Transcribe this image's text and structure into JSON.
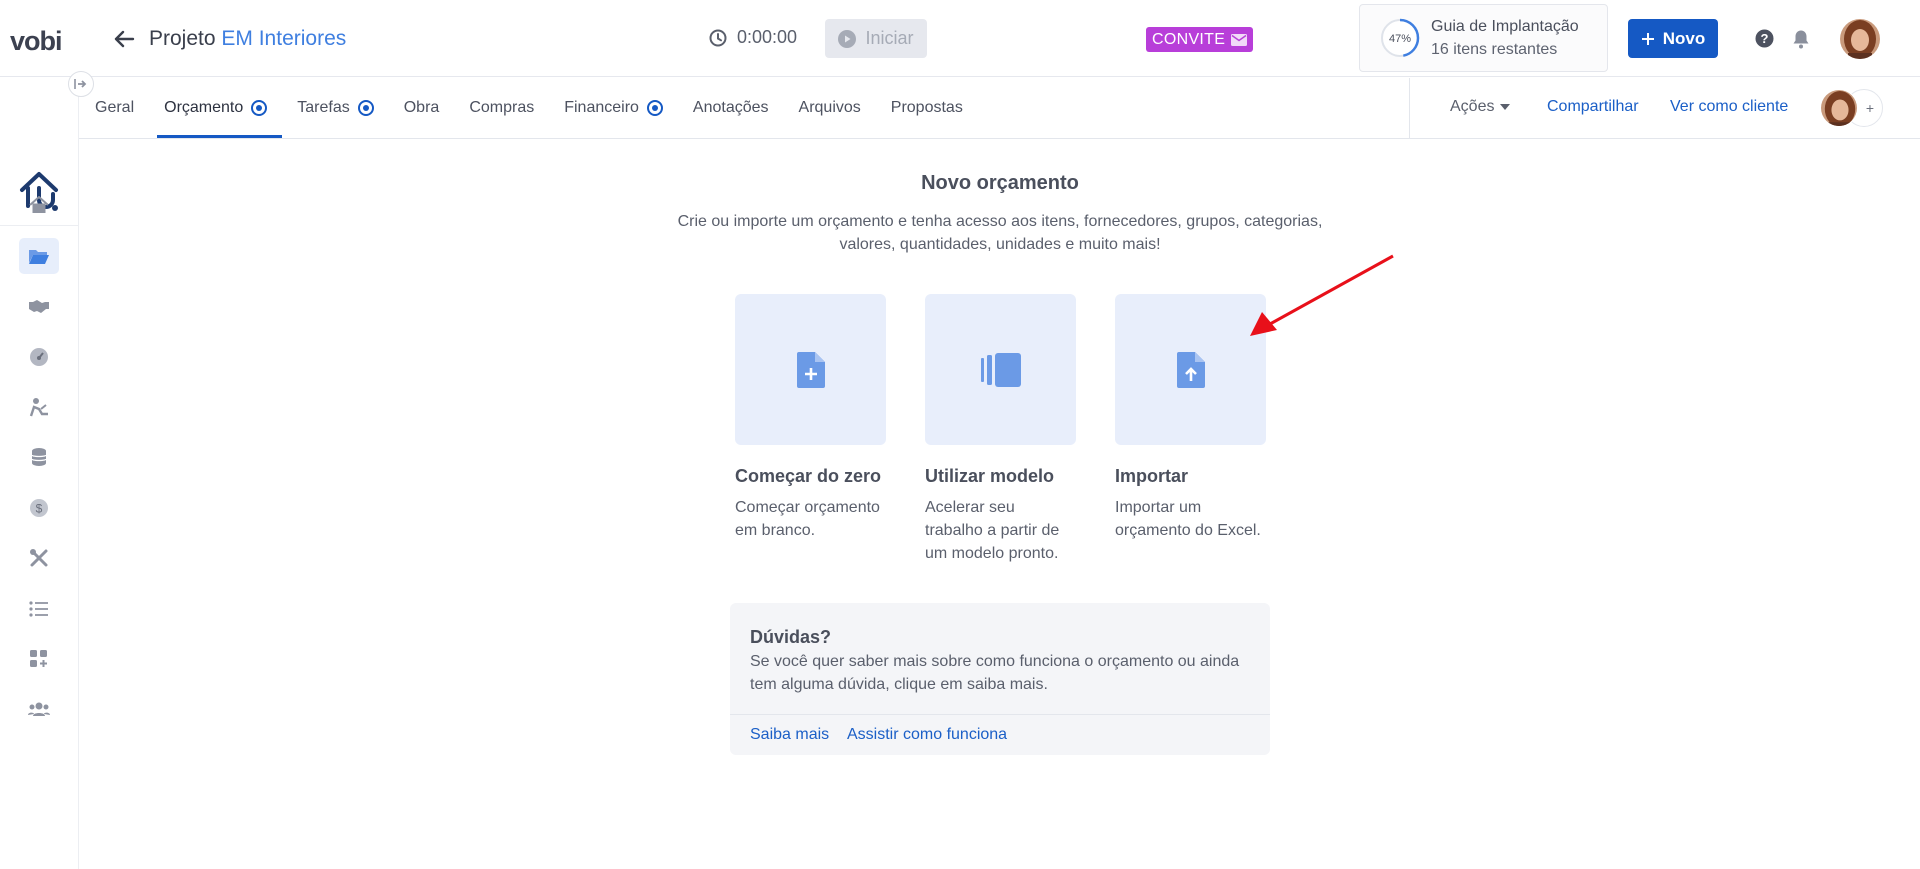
{
  "app": {
    "logo": "vobi"
  },
  "header": {
    "project_prefix": "Projeto",
    "project_name": "EM Interiores",
    "timer": "0:00:00",
    "start_label": "Iniciar",
    "invite_label": "CONVITE",
    "guide": {
      "percent": "47%",
      "title": "Guia de Implantação",
      "subtitle": "16 itens restantes",
      "progress": 0.47
    },
    "new_label": "Novo"
  },
  "tabs": [
    {
      "label": "Geral",
      "dot": false
    },
    {
      "label": "Orçamento",
      "dot": true,
      "active": true
    },
    {
      "label": "Tarefas",
      "dot": true
    },
    {
      "label": "Obra",
      "dot": false
    },
    {
      "label": "Compras",
      "dot": false
    },
    {
      "label": "Financeiro",
      "dot": true
    },
    {
      "label": "Anotações",
      "dot": false
    },
    {
      "label": "Arquivos",
      "dot": false
    },
    {
      "label": "Propostas",
      "dot": false
    }
  ],
  "actions": {
    "acoes": "Ações",
    "share": "Compartilhar",
    "view_client": "Ver como cliente",
    "add": "+"
  },
  "sidebar": {
    "items": [
      "home-icon",
      "folder-icon",
      "handshake-icon",
      "gauge-icon",
      "worker-icon",
      "coins-icon",
      "dollar-icon",
      "tools-icon",
      "list-icon",
      "apps-add-icon",
      "users-icon"
    ]
  },
  "main": {
    "title": "Novo orçamento",
    "description": "Crie ou importe um orçamento e tenha acesso aos itens, fornecedores, grupos, categorias, valores, quantidades, unidades e muito mais!",
    "options": [
      {
        "title": "Começar do zero",
        "description": "Começar orçamento em branco."
      },
      {
        "title": "Utilizar modelo",
        "description": "Acelerar seu trabalho a partir de um modelo pronto."
      },
      {
        "title": "Importar",
        "description": "Importar um orçamento do Excel."
      }
    ],
    "help": {
      "title": "Dúvidas?",
      "description": "Se você quer saber mais sobre como funciona o orçamento ou ainda tem alguma dúvida, clique em saiba mais.",
      "link_more": "Saiba mais",
      "link_watch": "Assistir como funciona"
    }
  },
  "colors": {
    "primary": "#1559c4",
    "accent_blue": "#3f7fe0",
    "invite": "#b83ed9",
    "card_bg": "#e8eefb",
    "arrow": "#e8101a"
  }
}
